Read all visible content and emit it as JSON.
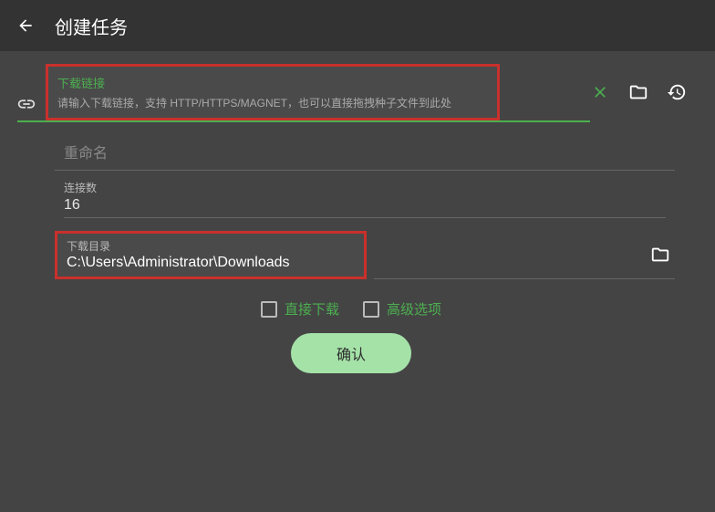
{
  "header": {
    "title": "创建任务"
  },
  "url_field": {
    "label": "下载链接",
    "placeholder": "请输入下载链接，支持 HTTP/HTTPS/MAGNET，也可以直接拖拽种子文件到此处"
  },
  "rename_field": {
    "placeholder": "重命名"
  },
  "connections": {
    "label": "连接数",
    "value": "16"
  },
  "download_dir": {
    "label": "下载目录",
    "value": "C:\\Users\\Administrator\\Downloads"
  },
  "checkboxes": {
    "direct_download": "直接下载",
    "advanced_options": "高级选项"
  },
  "confirm_button": "确认"
}
